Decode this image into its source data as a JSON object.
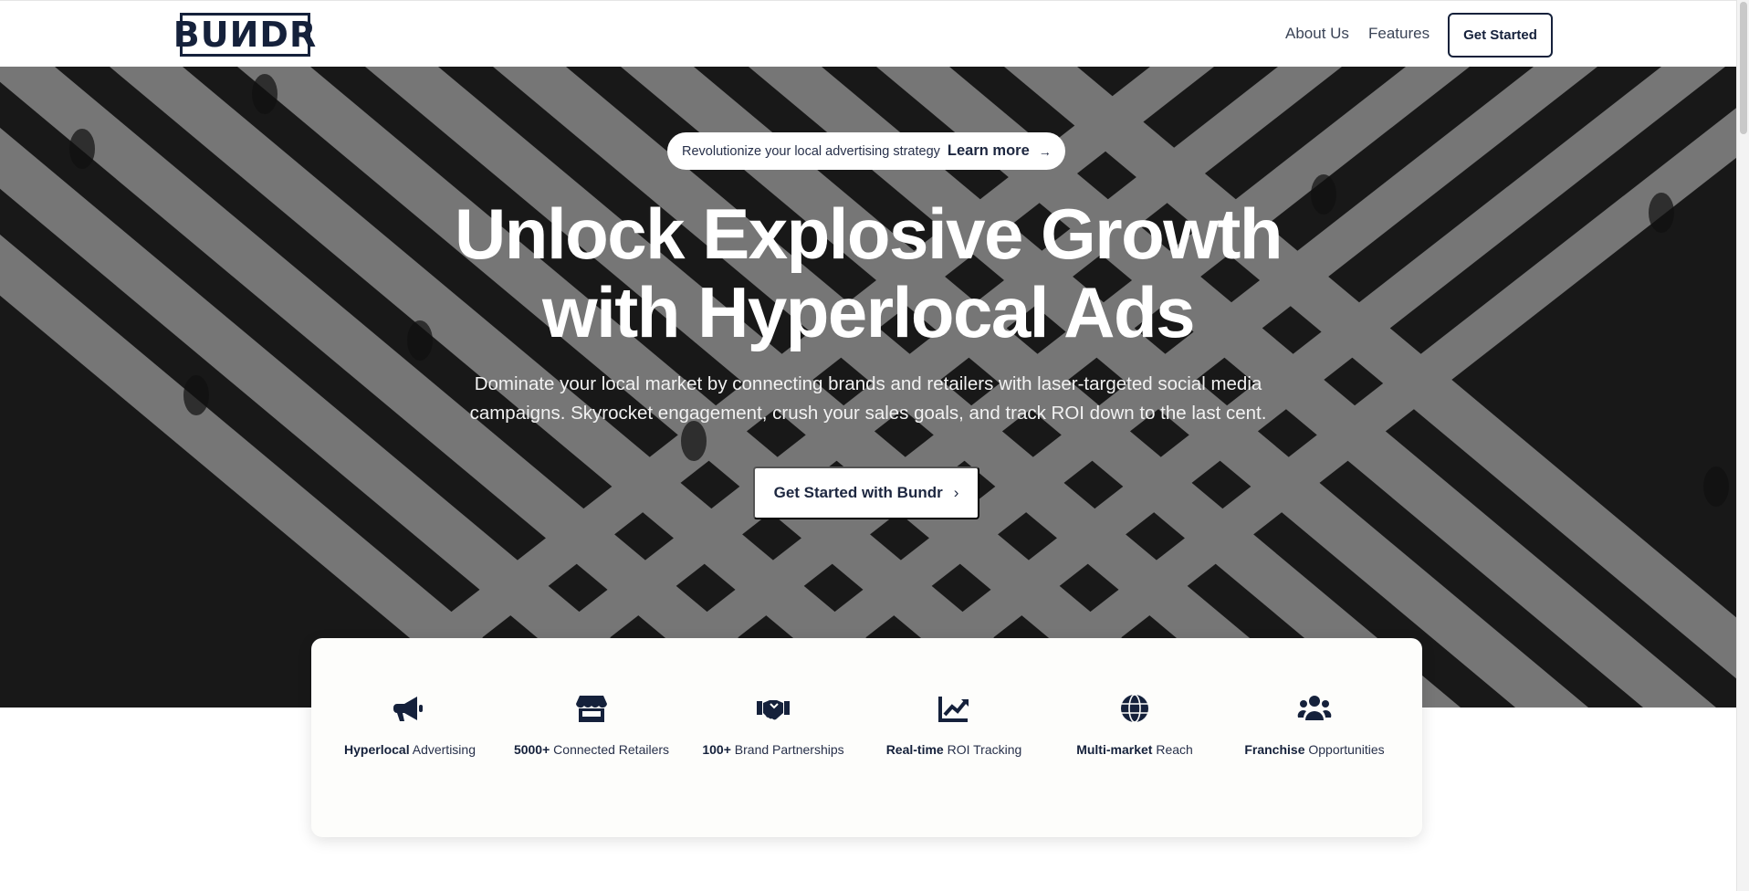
{
  "nav": {
    "logo": "BUИDR",
    "links": [
      "About Us",
      "Features"
    ],
    "cta": "Get Started"
  },
  "hero": {
    "pill_text": "Revolutionize your local advertising strategy",
    "pill_link": "Learn more",
    "pill_arrow": "→",
    "headline_line1": "Unlock Explosive Growth",
    "headline_line2": "with Hyperlocal Ads",
    "subtitle": "Dominate your local market by connecting brands and retailers with laser-targeted social media campaigns. Skyrocket engagement, crush your sales goals, and track ROI down to the last cent.",
    "cta": "Get Started with Bundr",
    "cta_chevron": "›"
  },
  "features": [
    {
      "strong": "Hyperlocal",
      "rest": " Advertising",
      "icon": "megaphone-icon"
    },
    {
      "strong": "5000+",
      "rest": " Connected Retailers",
      "icon": "store-icon"
    },
    {
      "strong": "100+",
      "rest": " Brand Partnerships",
      "icon": "handshake-icon"
    },
    {
      "strong": "Real-time",
      "rest": " ROI Tracking",
      "icon": "chart-line-icon"
    },
    {
      "strong": "Multi-market",
      "rest": " Reach",
      "icon": "globe-icon"
    },
    {
      "strong": "Franchise",
      "rest": " Opportunities",
      "icon": "users-icon"
    }
  ],
  "colors": {
    "brand": "#15213b",
    "hero_overlay": "#2b2b2b"
  }
}
